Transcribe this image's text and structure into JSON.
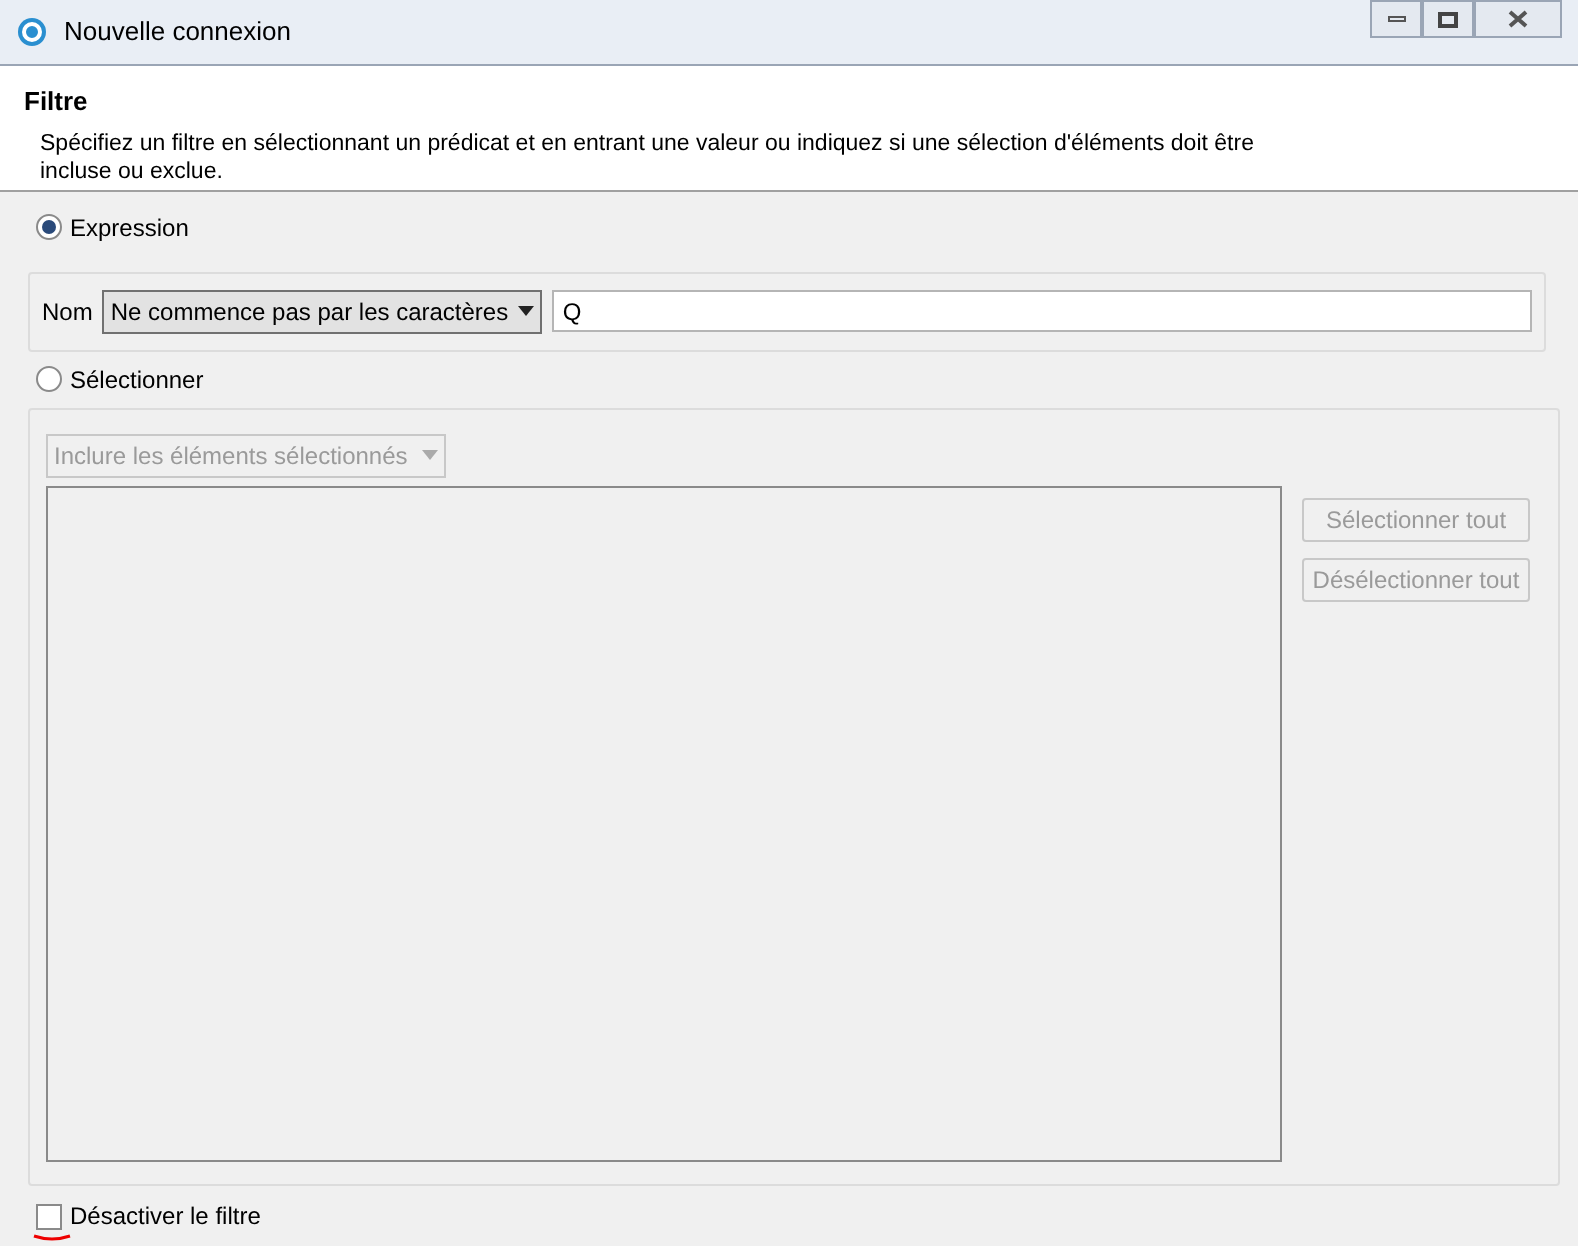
{
  "window": {
    "title": "Nouvelle connexion"
  },
  "header": {
    "title": "Filtre",
    "description": "Spécifiez un filtre en sélectionnant un prédicat et en entrant une valeur ou indiquez si une sélection d'éléments doit être incluse ou exclue."
  },
  "expression": {
    "label": "Expression",
    "selected": true,
    "field_label": "Nom",
    "predicate": "Ne commence pas par les caractères",
    "value": "Q"
  },
  "selection": {
    "label": "Sélectionner",
    "selected": false,
    "mode": "Inclure les éléments sélectionnés",
    "disabled": true,
    "buttons": [
      "Sélectionner tout",
      "Désélectionner tout"
    ]
  },
  "disable_filter": {
    "label": "Désactiver le filtre",
    "checked": false
  }
}
